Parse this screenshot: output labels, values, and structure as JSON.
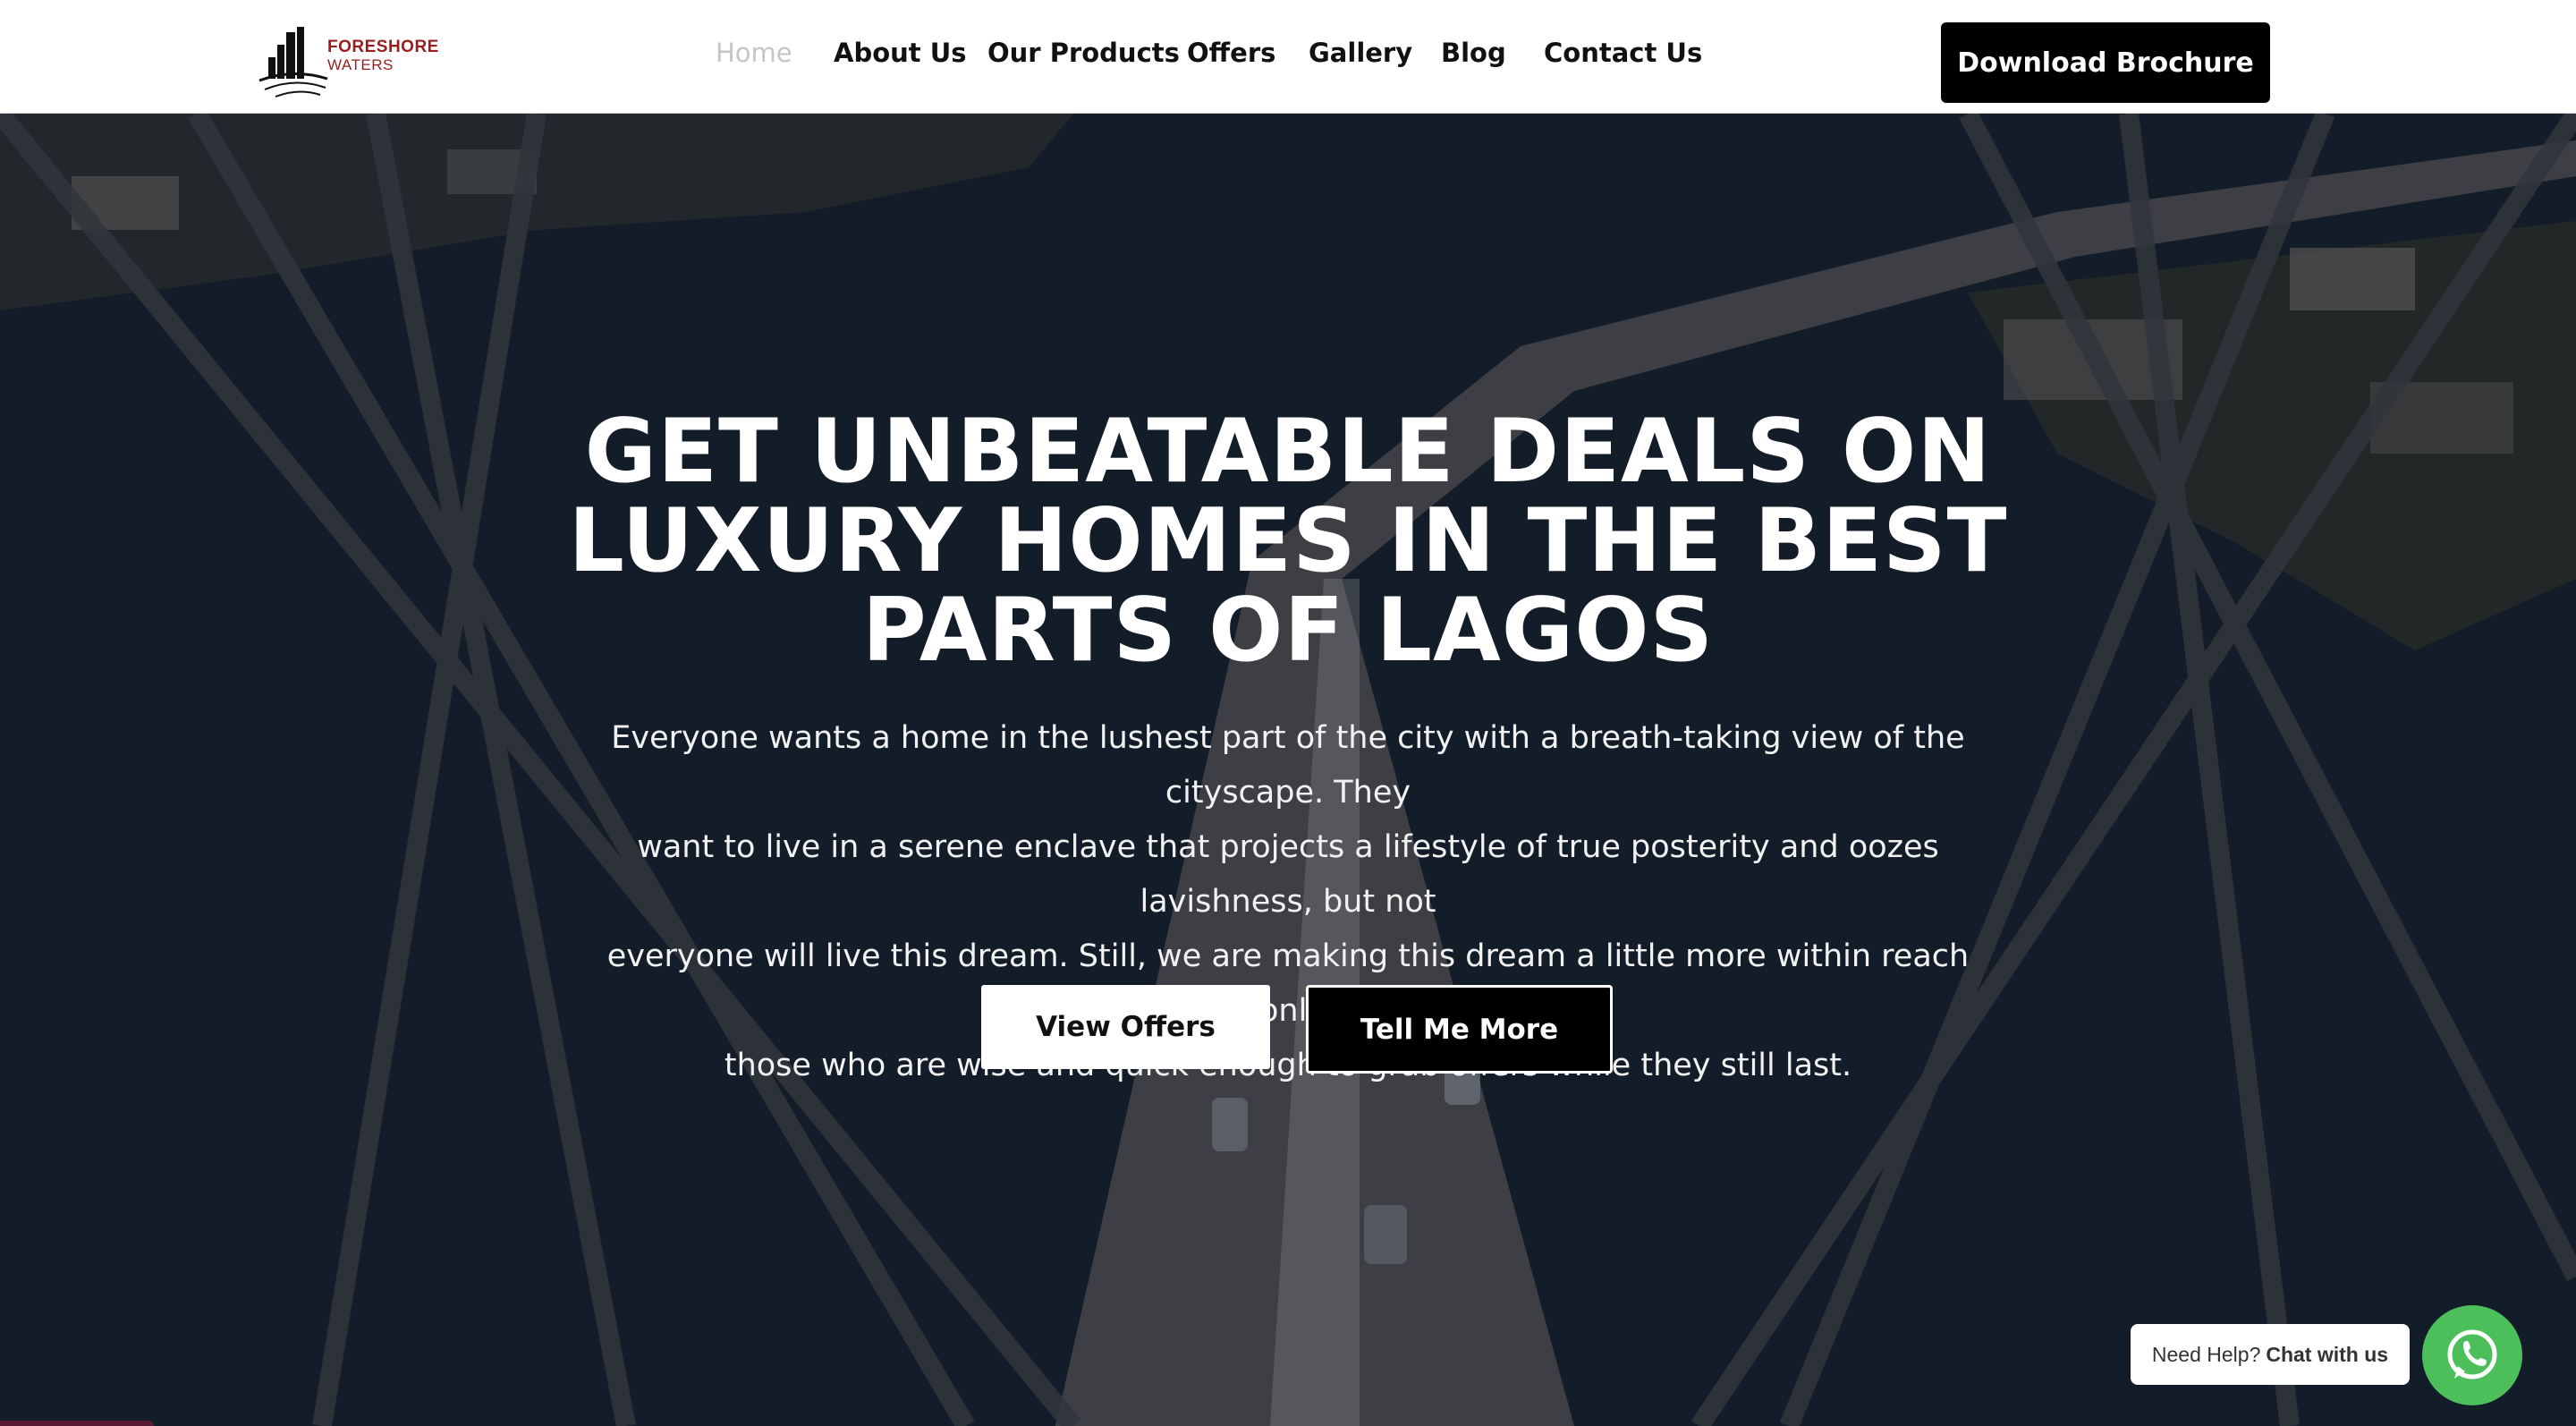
{
  "brand": {
    "line1": "FORESHORE",
    "line2": "WATERS",
    "color": "#9b1c1c"
  },
  "nav": {
    "items": [
      {
        "label": "Home",
        "active": true
      },
      {
        "label": "About Us",
        "active": false
      },
      {
        "label": "Our Products",
        "active": false
      },
      {
        "label": "Offers",
        "active": false
      },
      {
        "label": "Gallery",
        "active": false
      },
      {
        "label": "Blog",
        "active": false
      },
      {
        "label": "Contact Us",
        "active": false
      }
    ],
    "cta": "Download Brochure"
  },
  "hero": {
    "headline_lines": [
      "GET UNBEATABLE DEALS ON",
      "LUXURY HOMES IN THE BEST",
      "PARTS OF LAGOS"
    ],
    "body_lines": [
      "Everyone wants a home in the lushest part of the city with a breath-taking view of the cityscape. They",
      "want to live in a serene enclave that projects a lifestyle of true posterity and oozes lavishness, but not",
      "everyone will live this dream. Still, we are making this dream a little more within reach but only for",
      "those who are wise and quick enough to grab offers while they still last."
    ],
    "primary_button": "View Offers",
    "secondary_button": "Tell Me More"
  },
  "chat": {
    "prefix": "Need Help?",
    "action": "Chat with us",
    "icon": "whatsapp-icon",
    "color": "#4cbe5a"
  }
}
